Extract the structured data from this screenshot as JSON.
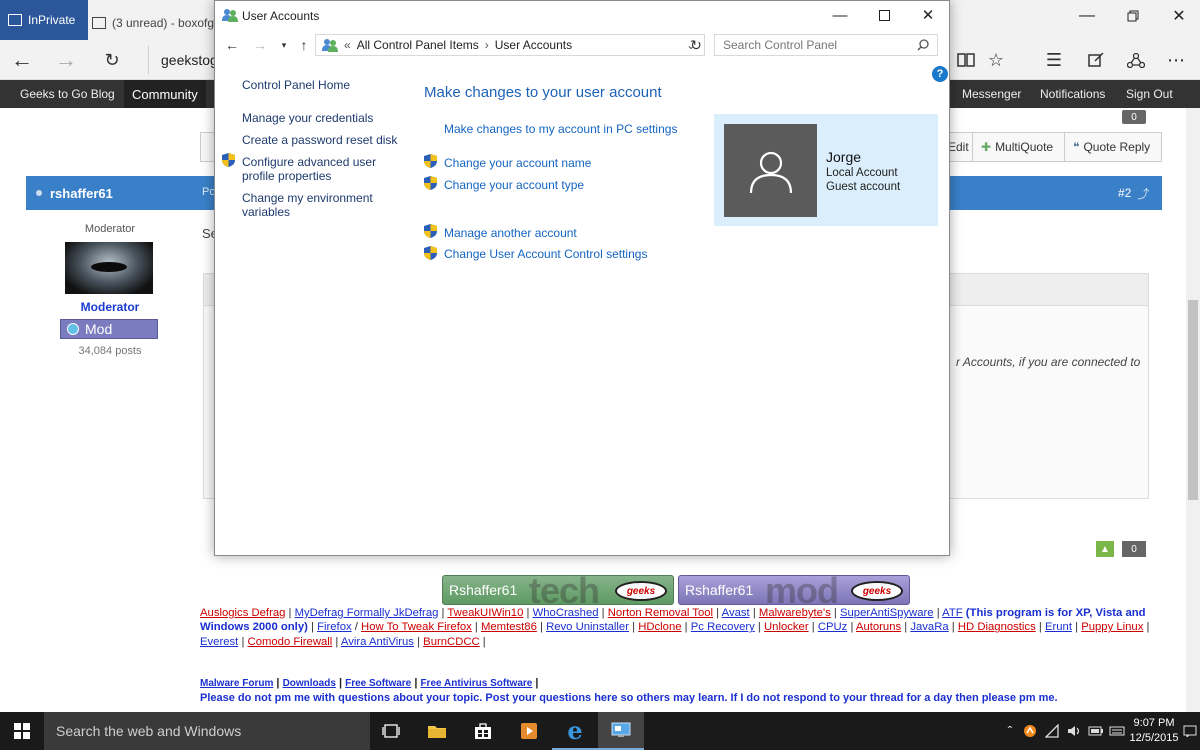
{
  "browser": {
    "inprivate_label": "InPrivate",
    "tab1_title": "(3 unread) - boxofg",
    "url_text": "geekstogo"
  },
  "site_nav": {
    "items": [
      "Geeks to Go Blog",
      "Community",
      "Messenger",
      "Notifications",
      "Sign Out"
    ]
  },
  "post": {
    "zero_top": "0",
    "buttons": [
      "Edit",
      "MultiQuote",
      "Quote Reply"
    ],
    "username": "rshaffer61",
    "post_label": "Po",
    "post_number": "#2",
    "role_label": "Moderator",
    "rank_name": "Moderator",
    "badge_label": "Mod",
    "post_count": "34,084 posts",
    "text_start": "Se",
    "quote_excerpt": "r Accounts, if you are connected to",
    "zero_bottom": "0"
  },
  "signature": {
    "banner1_text": "Rshaffer61",
    "banner1_big": "tech",
    "banner2_text": "Rshaffer61",
    "banner2_big": "mod",
    "pill_text": "geeks",
    "links_row1": [
      "Auslogics Defrag",
      "MyDefrag Formally JkDefrag",
      "TweakUIWin10",
      "WhoCrashed",
      "Norton Removal Tool",
      "Avast",
      "Malwarebyte's",
      "SuperAntiSpyware",
      "ATF"
    ],
    "atf_note": "(This program is for XP, Vista and Windows 2000 only)",
    "links_row2": [
      "Firefox",
      "How To Tweak Firefox",
      "Memtest86",
      "Revo Uninstaller",
      "HDclone",
      "Pc Recovery",
      "Unlocker",
      "CPUz",
      "Autoruns",
      "JavaRa",
      "HD Diagnostics",
      "Erunt"
    ],
    "links_row3": [
      "Puppy Linux",
      "Everest",
      "Comodo Firewall",
      "Avira AntiVirus",
      "BurnCDCC"
    ],
    "footer_links": [
      "Malware Forum",
      "Downloads",
      "Free Software",
      "Free Antivirus Software"
    ],
    "footer_message": "Please do not pm me with questions about your topic. Post your questions here so others may learn. If I do not respond to your thread for a day then please pm me."
  },
  "user_accounts": {
    "title": "User Accounts",
    "breadcrumb": [
      "All Control Panel Items",
      "User Accounts"
    ],
    "search_placeholder": "Search Control Panel",
    "left_links": [
      "Control Panel Home",
      "Manage your credentials",
      "Create a password reset disk",
      "Configure advanced user",
      "profile properties",
      "Change my environment",
      "variables"
    ],
    "heading": "Make changes to your user account",
    "pc_settings_link": "Make changes to my account in PC settings",
    "actions": [
      "Change your account name",
      "Change your account type",
      "Manage another account",
      "Change User Account Control settings"
    ],
    "account": {
      "name": "Jorge",
      "type1": "Local Account",
      "type2": "Guest account"
    }
  },
  "taskbar": {
    "search_text": "Search the web and Windows",
    "time": "9:07 PM",
    "date": "12/5/2015"
  }
}
